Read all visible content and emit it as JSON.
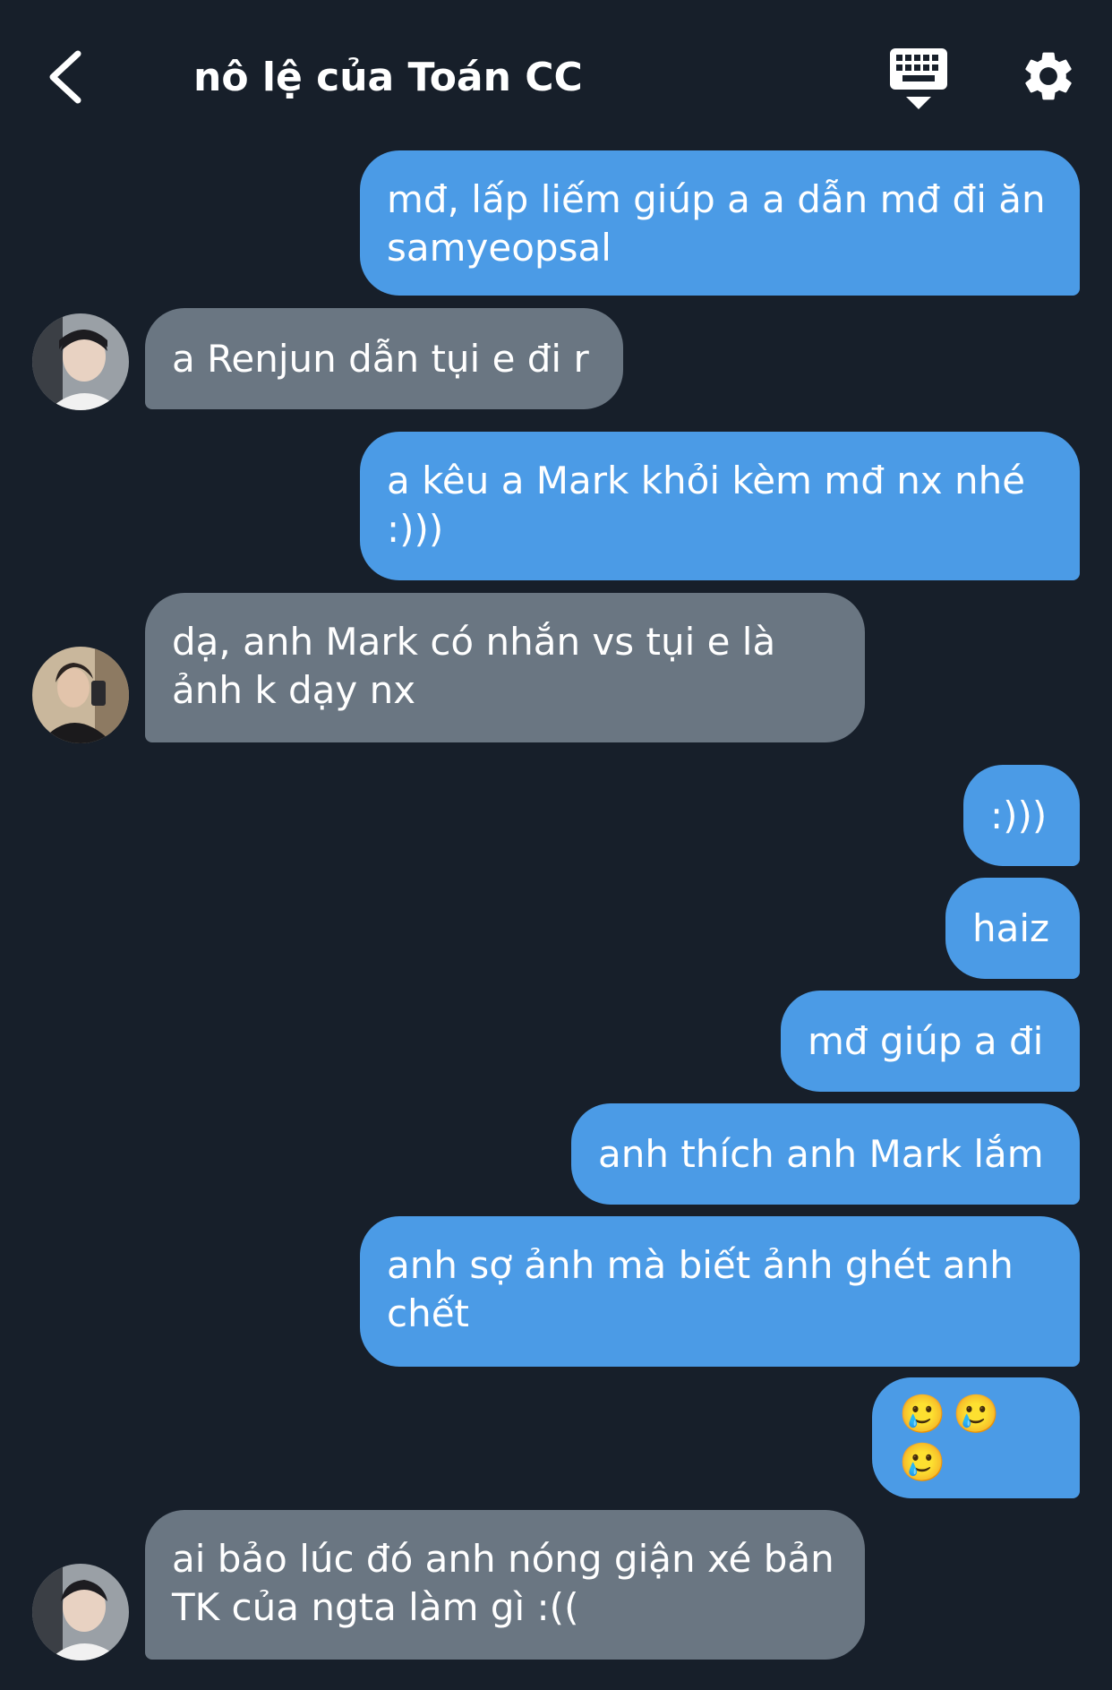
{
  "header": {
    "title": "nô lệ của Toán CC",
    "back_icon": "chevron-left-icon",
    "keyboard_icon": "keyboard-icon",
    "settings_icon": "gear-icon"
  },
  "colors": {
    "background": "#171f2a",
    "sent_bubble": "#4b9be6",
    "received_bubble": "#6a7682",
    "text": "#ffffff"
  },
  "messages": [
    {
      "side": "sent",
      "text": "mđ, lấp liếm giúp a a dẫn mđ đi ăn samyeopsal"
    },
    {
      "side": "received",
      "text": "a Renjun dẫn tụi e đi r"
    },
    {
      "side": "sent",
      "text": "a kêu a Mark khỏi kèm mđ nx nhé :)))"
    },
    {
      "side": "received",
      "text": "dạ, anh Mark có nhắn vs tụi e là ảnh k dạy nx"
    },
    {
      "side": "sent",
      "text": ":)))"
    },
    {
      "side": "sent",
      "text": "haiz"
    },
    {
      "side": "sent",
      "text": "mđ giúp a đi"
    },
    {
      "side": "sent",
      "text": "anh thích anh Mark lắm"
    },
    {
      "side": "sent",
      "text": "anh sợ ảnh mà biết ảnh ghét anh chết"
    },
    {
      "side": "sent",
      "text": "🥲🥲🥲"
    },
    {
      "side": "received",
      "text": "ai bảo lúc đó anh nóng giận xé bản TK của ngta làm gì :(("
    }
  ]
}
